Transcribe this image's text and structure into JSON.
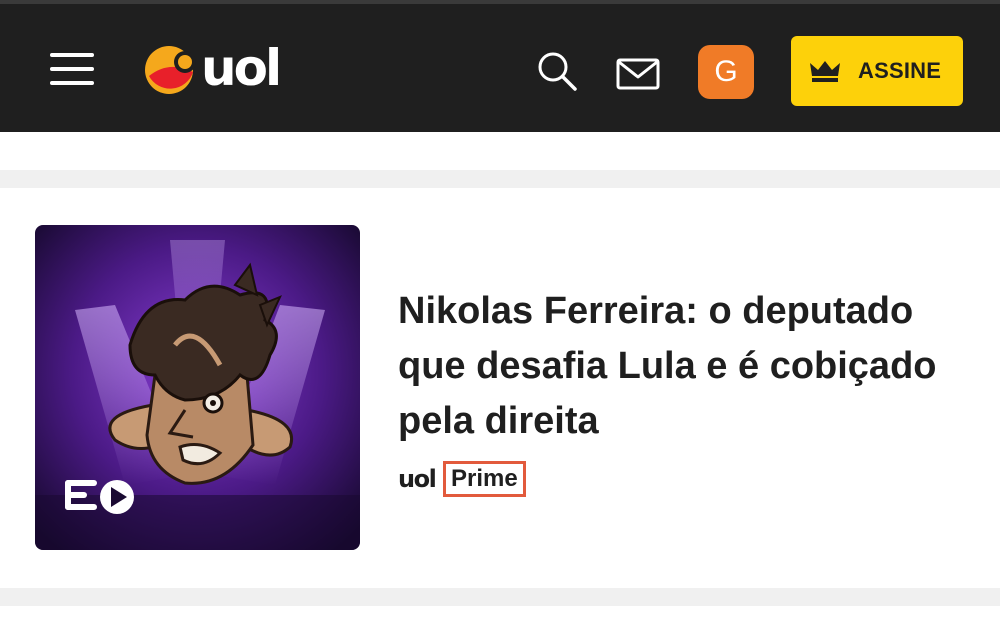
{
  "header": {
    "menu_icon": "hamburger-menu-icon",
    "logo_text": "uol",
    "search_icon": "search-icon",
    "mail_icon": "mail-icon",
    "avatar_initial": "G",
    "subscribe_label": "ASSINE",
    "subscribe_icon": "crown-icon"
  },
  "article": {
    "headline": "Nikolas Ferreira: o deputado que desafia Lula e é cobiçado pela direita",
    "brand_uol": "uol",
    "brand_prime": "Prime",
    "media_badge_icon": "audio-video-icon"
  },
  "colors": {
    "header_bg": "#1f1f1f",
    "subscribe_bg": "#fdd10a",
    "avatar_bg": "#f07b27",
    "prime_border": "#e25a3c",
    "separator": "#f0f0f0"
  }
}
